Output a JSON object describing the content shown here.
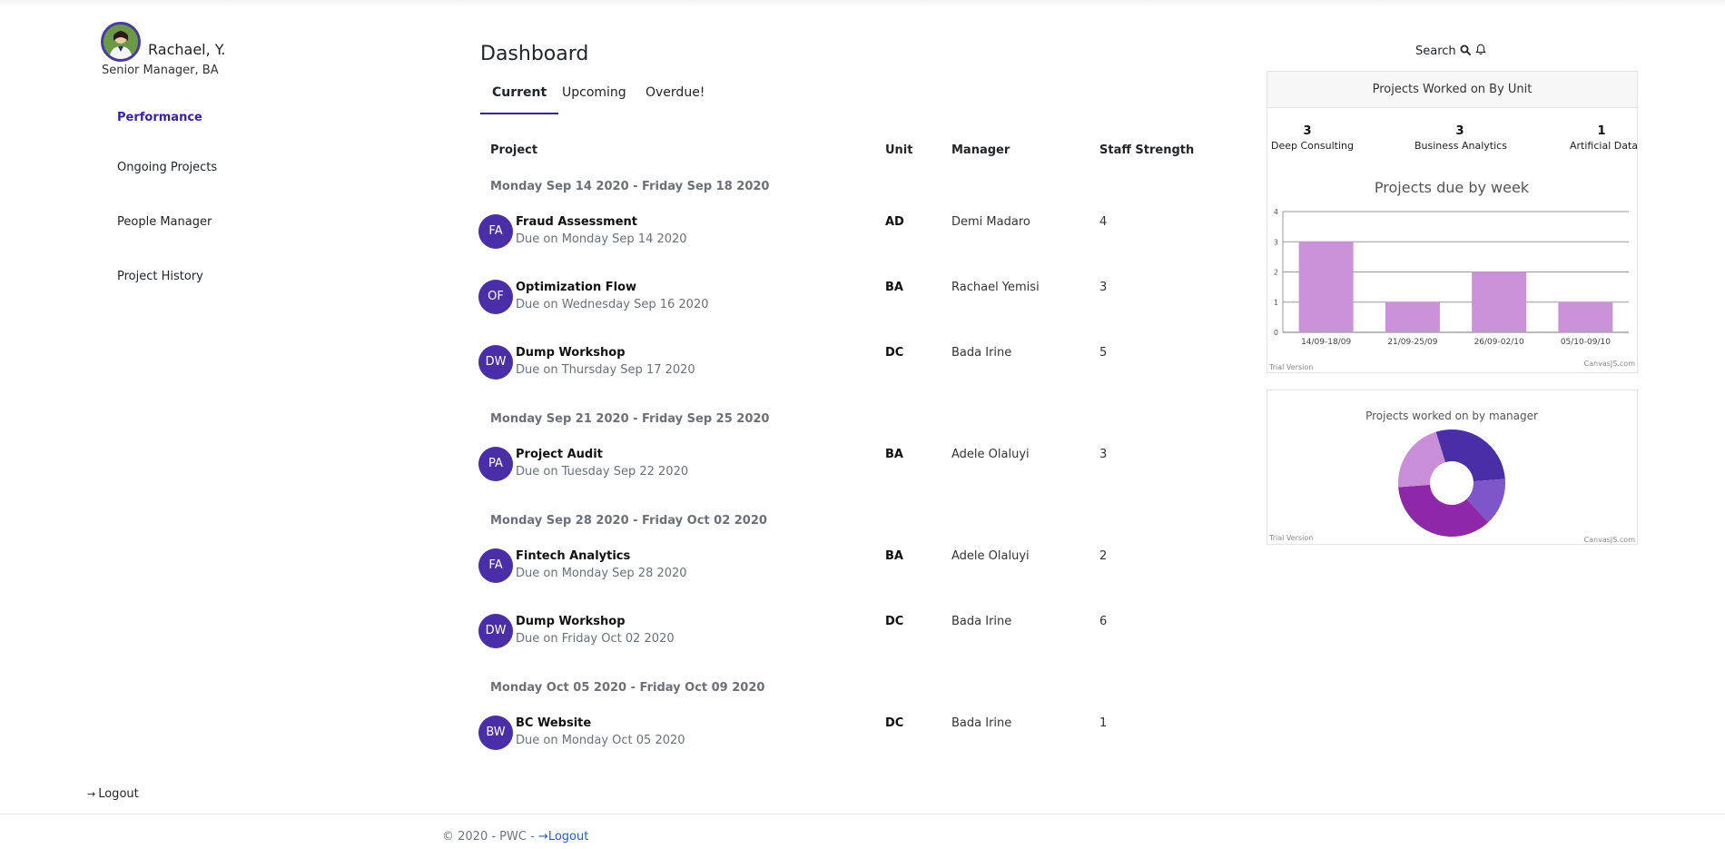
{
  "user": {
    "name": "Rachael, Y.",
    "role": "Senior Manager, BA"
  },
  "sidebar": {
    "items": [
      {
        "label": "Performance",
        "active": true
      },
      {
        "label": "Ongoing Projects",
        "active": false
      },
      {
        "label": "People Manager",
        "active": false
      },
      {
        "label": "Project History",
        "active": false
      }
    ],
    "logout_label": "Logout"
  },
  "main": {
    "title": "Dashboard",
    "tabs": [
      {
        "label": "Current",
        "active": true
      },
      {
        "label": "Upcoming",
        "active": false
      },
      {
        "label": "Overdue!",
        "active": false
      }
    ],
    "columns": [
      "Project",
      "Unit",
      "Manager",
      "Staff Strength"
    ],
    "weeks": [
      {
        "label": "Monday Sep 14 2020 - Friday Sep 18 2020",
        "projects": [
          {
            "initials": "FA",
            "name": "Fraud Assessment",
            "due": "Due on Monday Sep 14 2020",
            "unit": "AD",
            "manager": "Demi Madaro",
            "staff": "4"
          },
          {
            "initials": "OF",
            "name": "Optimization Flow",
            "due": "Due on Wednesday Sep 16 2020",
            "unit": "BA",
            "manager": "Rachael Yemisi",
            "staff": "3"
          },
          {
            "initials": "DW",
            "name": "Dump Workshop",
            "due": "Due on Thursday Sep 17 2020",
            "unit": "DC",
            "manager": "Bada Irine",
            "staff": "5"
          }
        ]
      },
      {
        "label": "Monday Sep 21 2020 - Friday Sep 25 2020",
        "projects": [
          {
            "initials": "PA",
            "name": "Project Audit",
            "due": "Due on Tuesday Sep 22 2020",
            "unit": "BA",
            "manager": "Adele Olaluyi",
            "staff": "3"
          }
        ]
      },
      {
        "label": "Monday Sep 28 2020 - Friday Oct 02 2020",
        "projects": [
          {
            "initials": "FA",
            "name": "Fintech Analytics",
            "due": "Due on Monday Sep 28 2020",
            "unit": "BA",
            "manager": "Adele Olaluyi",
            "staff": "2"
          },
          {
            "initials": "DW",
            "name": "Dump Workshop",
            "due": "Due on Friday Oct 02 2020",
            "unit": "DC",
            "manager": "Bada Irine",
            "staff": "6"
          }
        ]
      },
      {
        "label": "Monday Oct 05 2020 - Friday Oct 09 2020",
        "projects": [
          {
            "initials": "BW",
            "name": "BC Website",
            "due": "Due on Monday Oct 05 2020",
            "unit": "DC",
            "manager": "Bada Irine",
            "staff": "1"
          }
        ]
      }
    ]
  },
  "header": {
    "search_label": "Search",
    "search_icon": "magnifier-icon",
    "bell_icon": "bell-icon"
  },
  "units_card": {
    "title": "Projects Worked on By Unit",
    "stats": [
      {
        "value": "3",
        "label": "Deep Consulting"
      },
      {
        "value": "3",
        "label": "Business Analytics"
      },
      {
        "value": "1",
        "label": "Artificial Data"
      }
    ]
  },
  "chart_data": [
    {
      "type": "bar",
      "title": "Projects due by week",
      "categories": [
        "14/09-18/09",
        "21/09-25/09",
        "26/09-02/10",
        "05/10-09/10"
      ],
      "values": [
        3,
        1,
        2,
        1
      ],
      "ylim": [
        0,
        4
      ],
      "yticks": [
        "0",
        "1",
        "2",
        "3",
        "4"
      ],
      "color": "#cc92d9",
      "grid": true,
      "watermark_left": "Trial Version",
      "watermark_right": "CanvasJS.com"
    },
    {
      "type": "pie",
      "title": "Projects worked on by manager",
      "slices": [
        {
          "value": 2,
          "color": "#4a2ea8"
        },
        {
          "value": 1,
          "color": "#7f56c9"
        },
        {
          "value": 2.5,
          "color": "#8f28a8"
        },
        {
          "value": 1.5,
          "color": "#c98ed8"
        }
      ],
      "watermark_left": "Trial Version",
      "watermark_right": "CanvasJS.com"
    }
  ],
  "footer": {
    "copyright": "© 2020 - PWC -",
    "logout_label": "Logout"
  }
}
